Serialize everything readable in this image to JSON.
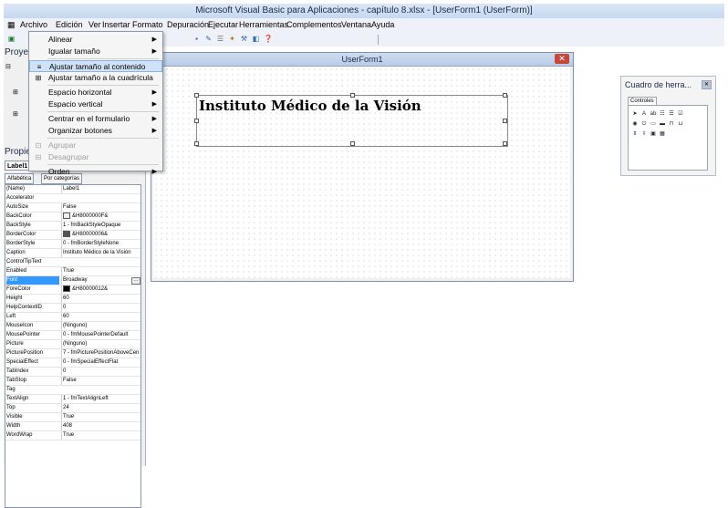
{
  "window": {
    "title": "Microsoft Visual Basic para Aplicaciones - capítulo 8.xlsx - [UserForm1 (UserForm)]"
  },
  "menubar": [
    "Archivo",
    "Edición",
    "Ver",
    "Insertar",
    "Formato",
    "Depuración",
    "Ejecutar",
    "Herramientas",
    "Complementos",
    "Ventana",
    "Ayuda"
  ],
  "left_pane": {
    "project_title": "Proyec",
    "properties_title": "Propie",
    "object_combo": "Label1",
    "tabs": [
      "Alfabética",
      "Por categorías"
    ]
  },
  "format_menu": {
    "items": [
      {
        "label": "Alinear",
        "icon": "",
        "submenu": true,
        "disabled": false,
        "highlighted": false
      },
      {
        "label": "Igualar tamaño",
        "icon": "",
        "submenu": true,
        "disabled": false,
        "highlighted": false
      },
      {
        "label": "Ajustar tamaño al contenido",
        "icon": "≡",
        "submenu": false,
        "disabled": false,
        "highlighted": true
      },
      {
        "label": "Ajustar tamaño a la cuadrícula",
        "icon": "⊞",
        "submenu": false,
        "disabled": false,
        "highlighted": false
      },
      {
        "label": "Espacio horizontal",
        "icon": "",
        "submenu": true,
        "disabled": false,
        "highlighted": false
      },
      {
        "label": "Espacio vertical",
        "icon": "",
        "submenu": true,
        "disabled": false,
        "highlighted": false
      },
      {
        "label": "Centrar en el formulario",
        "icon": "",
        "submenu": true,
        "disabled": false,
        "highlighted": false
      },
      {
        "label": "Organizar botones",
        "icon": "",
        "submenu": true,
        "disabled": false,
        "highlighted": false
      },
      {
        "label": "Agrupar",
        "icon": "⊡",
        "submenu": false,
        "disabled": true,
        "highlighted": false
      },
      {
        "label": "Desagrupar",
        "icon": "⊟",
        "submenu": false,
        "disabled": true,
        "highlighted": false
      },
      {
        "label": "Orden",
        "icon": "",
        "submenu": true,
        "disabled": false,
        "highlighted": false
      }
    ]
  },
  "properties": [
    {
      "name": "(Name)",
      "value": "Label1"
    },
    {
      "name": "Accelerator",
      "value": ""
    },
    {
      "name": "AutoSize",
      "value": "False"
    },
    {
      "name": "BackColor",
      "value": "&H8000000F&",
      "swatch": "#f0f0f0"
    },
    {
      "name": "BackStyle",
      "value": "1 - fmBackStyleOpaque"
    },
    {
      "name": "BorderColor",
      "value": "&H80000006&",
      "swatch": "#555555"
    },
    {
      "name": "BorderStyle",
      "value": "0 - fmBorderStyleNone"
    },
    {
      "name": "Caption",
      "value": "Instituto Médico de la Visión"
    },
    {
      "name": "ControlTipText",
      "value": ""
    },
    {
      "name": "Enabled",
      "value": "True"
    },
    {
      "name": "Font",
      "value": "Broadway",
      "selected": true
    },
    {
      "name": "ForeColor",
      "value": "&H80000012&",
      "swatch": "#000000"
    },
    {
      "name": "Height",
      "value": "60"
    },
    {
      "name": "HelpContextID",
      "value": "0"
    },
    {
      "name": "Left",
      "value": "60"
    },
    {
      "name": "MouseIcon",
      "value": "(Ninguno)"
    },
    {
      "name": "MousePointer",
      "value": "0 - fmMousePointerDefault"
    },
    {
      "name": "Picture",
      "value": "(Ninguno)"
    },
    {
      "name": "PicturePosition",
      "value": "7 - fmPicturePositionAboveCen"
    },
    {
      "name": "SpecialEffect",
      "value": "0 - fmSpecialEffectFlat"
    },
    {
      "name": "TabIndex",
      "value": "0"
    },
    {
      "name": "TabStop",
      "value": "False"
    },
    {
      "name": "Tag",
      "value": ""
    },
    {
      "name": "TextAlign",
      "value": "1 - fmTextAlignLeft"
    },
    {
      "name": "Top",
      "value": "24"
    },
    {
      "name": "Visible",
      "value": "True"
    },
    {
      "name": "Width",
      "value": "408"
    },
    {
      "name": "WordWrap",
      "value": "True"
    }
  ],
  "userform": {
    "title": "UserForm1",
    "label_caption": "Instituto Médico de la Visión"
  },
  "toolbox": {
    "title": "Cuadro de herra...",
    "tab": "Controles",
    "tools": [
      "pointer-icon",
      "label-tool-icon",
      "textbox-tool-icon",
      "combobox-tool-icon",
      "listbox-tool-icon",
      "checkbox-tool-icon",
      "optionbutton-tool-icon",
      "togglebutton-tool-icon",
      "frame-tool-icon",
      "commandbutton-tool-icon",
      "tabstrip-tool-icon",
      "multipage-tool-icon",
      "scrollbar-tool-icon",
      "spinbutton-tool-icon",
      "image-tool-icon",
      "refedit-tool-icon"
    ]
  },
  "colors": {
    "accent": "#3399ff",
    "menu_highlight": "#cfe2f8",
    "close_button": "#c5483a"
  }
}
